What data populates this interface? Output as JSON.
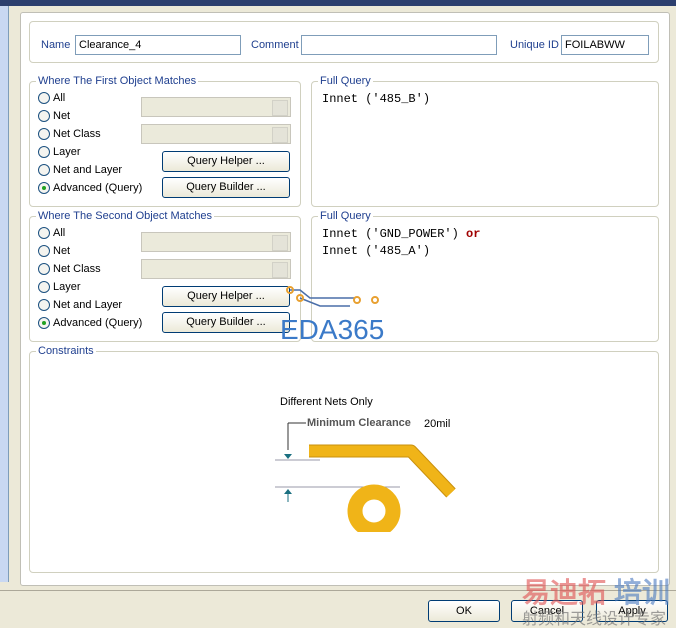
{
  "name": {
    "label": "Name",
    "value": "Clearance_4"
  },
  "comment": {
    "label": "Comment",
    "value": ""
  },
  "unique_id": {
    "label": "Unique ID",
    "value": "FOILABWW"
  },
  "first": {
    "title": "Where The First Object Matches",
    "options": [
      "All",
      "Net",
      "Net Class",
      "Layer",
      "Net and Layer",
      "Advanced (Query)"
    ],
    "selected": "Advanced (Query)",
    "query_helper": "Query Helper ...",
    "query_builder": "Query Builder ...",
    "full_query_title": "Full Query",
    "query_line1": "Innet ('485_B')"
  },
  "second": {
    "title": "Where The Second Object Matches",
    "options": [
      "All",
      "Net",
      "Net Class",
      "Layer",
      "Net and Layer",
      "Advanced (Query)"
    ],
    "selected": "Advanced (Query)",
    "query_helper": "Query Helper ...",
    "query_builder": "Query Builder ...",
    "full_query_title": "Full Query",
    "query_line1": "Innet ('GND_POWER')",
    "query_kw": "or",
    "query_line2": "Innet ('485_A')"
  },
  "constraints": {
    "title": "Constraints",
    "mode": "Different Nets Only",
    "min_label": "Minimum Clearance",
    "min_value": "20mil"
  },
  "buttons": {
    "ok": "OK",
    "cancel": "Cancel",
    "apply": "Apply"
  },
  "watermarks": {
    "eda": "EDA365",
    "cn_title": "易迪拓培训",
    "cn_sub": "射频和天线设计专家"
  },
  "colors": {
    "copper": "#f0b418",
    "label": "#1f3f8f",
    "keyword": "#a00000"
  }
}
